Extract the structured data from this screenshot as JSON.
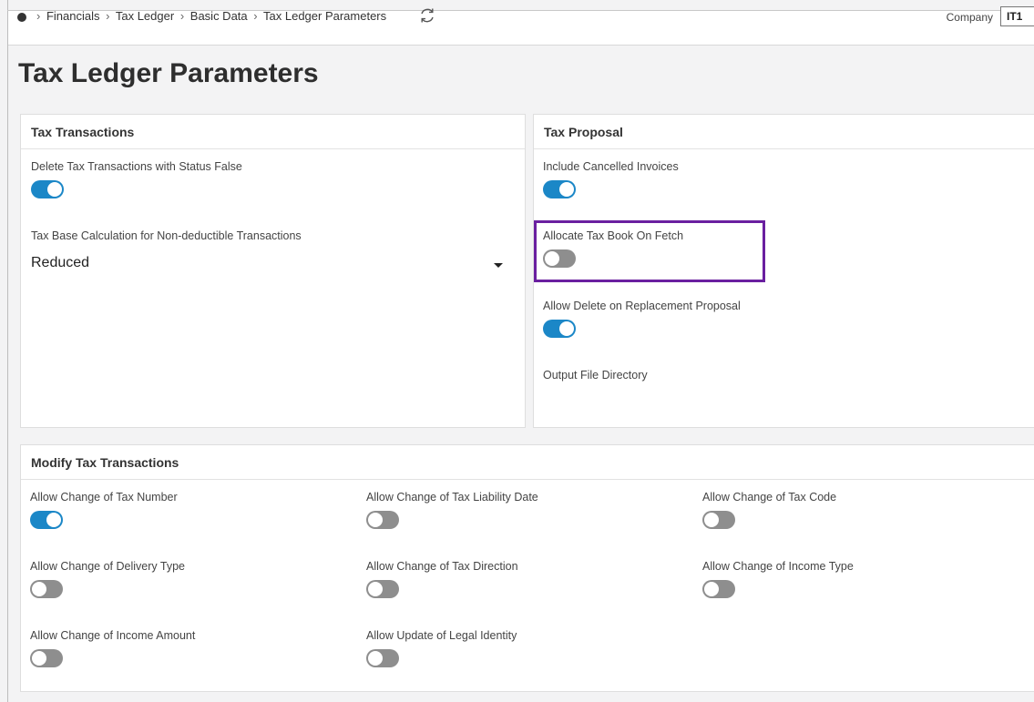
{
  "header": {
    "breadcrumbs": [
      "Financials",
      "Tax Ledger",
      "Basic Data",
      "Tax Ledger Parameters"
    ],
    "company_label": "Company",
    "company_value": "IT1"
  },
  "page_title": "Tax Ledger Parameters",
  "tax_transactions": {
    "title": "Tax Transactions",
    "delete_status_false": {
      "label": "Delete Tax Transactions with Status False",
      "on": true
    },
    "tax_base_calc": {
      "label": "Tax Base Calculation for Non-deductible Transactions",
      "value": "Reduced"
    }
  },
  "tax_proposal": {
    "title": "Tax Proposal",
    "include_cancelled": {
      "label": "Include Cancelled Invoices",
      "on": true
    },
    "allocate_tax_book": {
      "label": "Allocate Tax Book On Fetch",
      "on": false
    },
    "allow_delete_replacement": {
      "label": "Allow Delete on Replacement Proposal",
      "on": true
    },
    "output_dir": {
      "label": "Output File Directory"
    }
  },
  "modify": {
    "title": "Modify Tax Transactions",
    "items": [
      {
        "label": "Allow Change of Tax Number",
        "on": true
      },
      {
        "label": "Allow Change of Tax Liability Date",
        "on": false
      },
      {
        "label": "Allow Change of Tax Code",
        "on": false
      },
      {
        "label": "Allow Change of Delivery Type",
        "on": false
      },
      {
        "label": "Allow Change of Tax Direction",
        "on": false
      },
      {
        "label": "Allow Change of Income Type",
        "on": false
      },
      {
        "label": "Allow Change of Income Amount",
        "on": false
      },
      {
        "label": "Allow Update of Legal Identity",
        "on": false
      }
    ]
  },
  "colors": {
    "toggle_on": "#1b87c7",
    "toggle_off": "#8e8e8e",
    "highlight": "#6a1fa0"
  }
}
